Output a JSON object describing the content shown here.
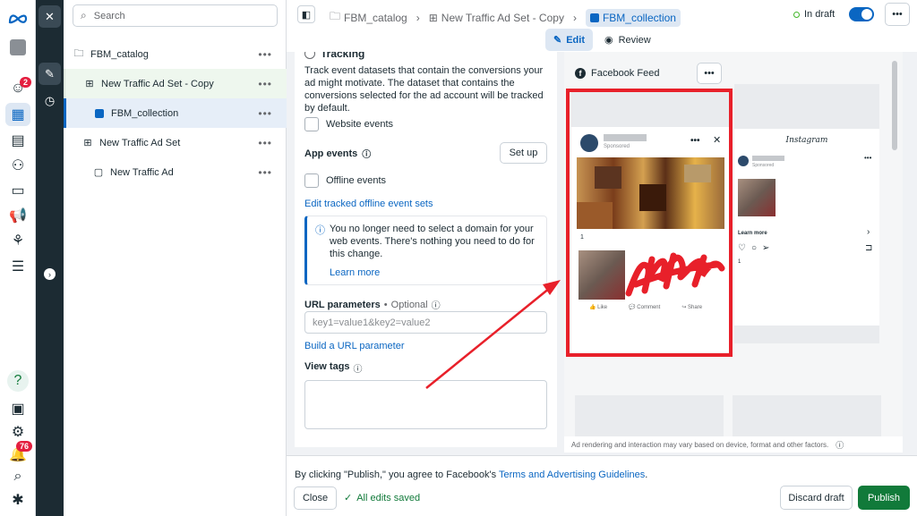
{
  "rail": {
    "notif_badge": "2",
    "alerts_badge": "76"
  },
  "tree": {
    "search_placeholder": "Search",
    "items": [
      {
        "label": "FBM_catalog"
      },
      {
        "label": "New Traffic Ad Set - Copy"
      },
      {
        "label": "FBM_collection"
      },
      {
        "label": "New Traffic Ad Set"
      },
      {
        "label": "New Traffic Ad"
      }
    ],
    "more": "•••"
  },
  "breadcrumb": {
    "c1": "FBM_catalog",
    "c2": "New Traffic Ad Set - Copy",
    "c3": "FBM_collection"
  },
  "status": {
    "label": "In draft"
  },
  "more_button": "•••",
  "tabs": {
    "edit": "Edit",
    "review": "Review"
  },
  "editor": {
    "section_title": "Tracking",
    "intro": "Track event datasets that contain the conversions your ad might motivate. The dataset that contains the conversions selected for the ad account will be tracked by default.",
    "website_events": "Website events",
    "app_events": "App events",
    "setup": "Set up",
    "offline_events": "Offline events",
    "edit_offline": "Edit tracked offline event sets",
    "info_text": "You no longer need to select a domain for your web events. There's nothing you need to do for this change.",
    "learn_more": "Learn more",
    "url_params": "URL parameters",
    "optional": "Optional",
    "url_placeholder": "key1=value1&key2=value2",
    "build_url": "Build a URL parameter",
    "view_tags": "View tags"
  },
  "preview": {
    "placement": "Facebook Feed",
    "more": "•••",
    "sponsored": "Sponsored",
    "count": "1",
    "like": "Like",
    "comment": "Comment",
    "share": "Share",
    "ig_brand": "Instagram",
    "ig_learn_more": "Learn more",
    "ig_count": "1",
    "disclaimer": "Ad rendering and interaction may vary based on device, format and other factors."
  },
  "footer": {
    "agree_prefix": "By clicking \"Publish,\" you agree to Facebook's ",
    "terms": "Terms and Advertising Guidelines",
    "agree_suffix": ".",
    "close": "Close",
    "saved": "All edits saved",
    "discard": "Discard draft",
    "publish": "Publish"
  },
  "colors": {
    "accent": "#0a66c2",
    "publish": "#117a3a",
    "annotation": "#e8202a"
  }
}
